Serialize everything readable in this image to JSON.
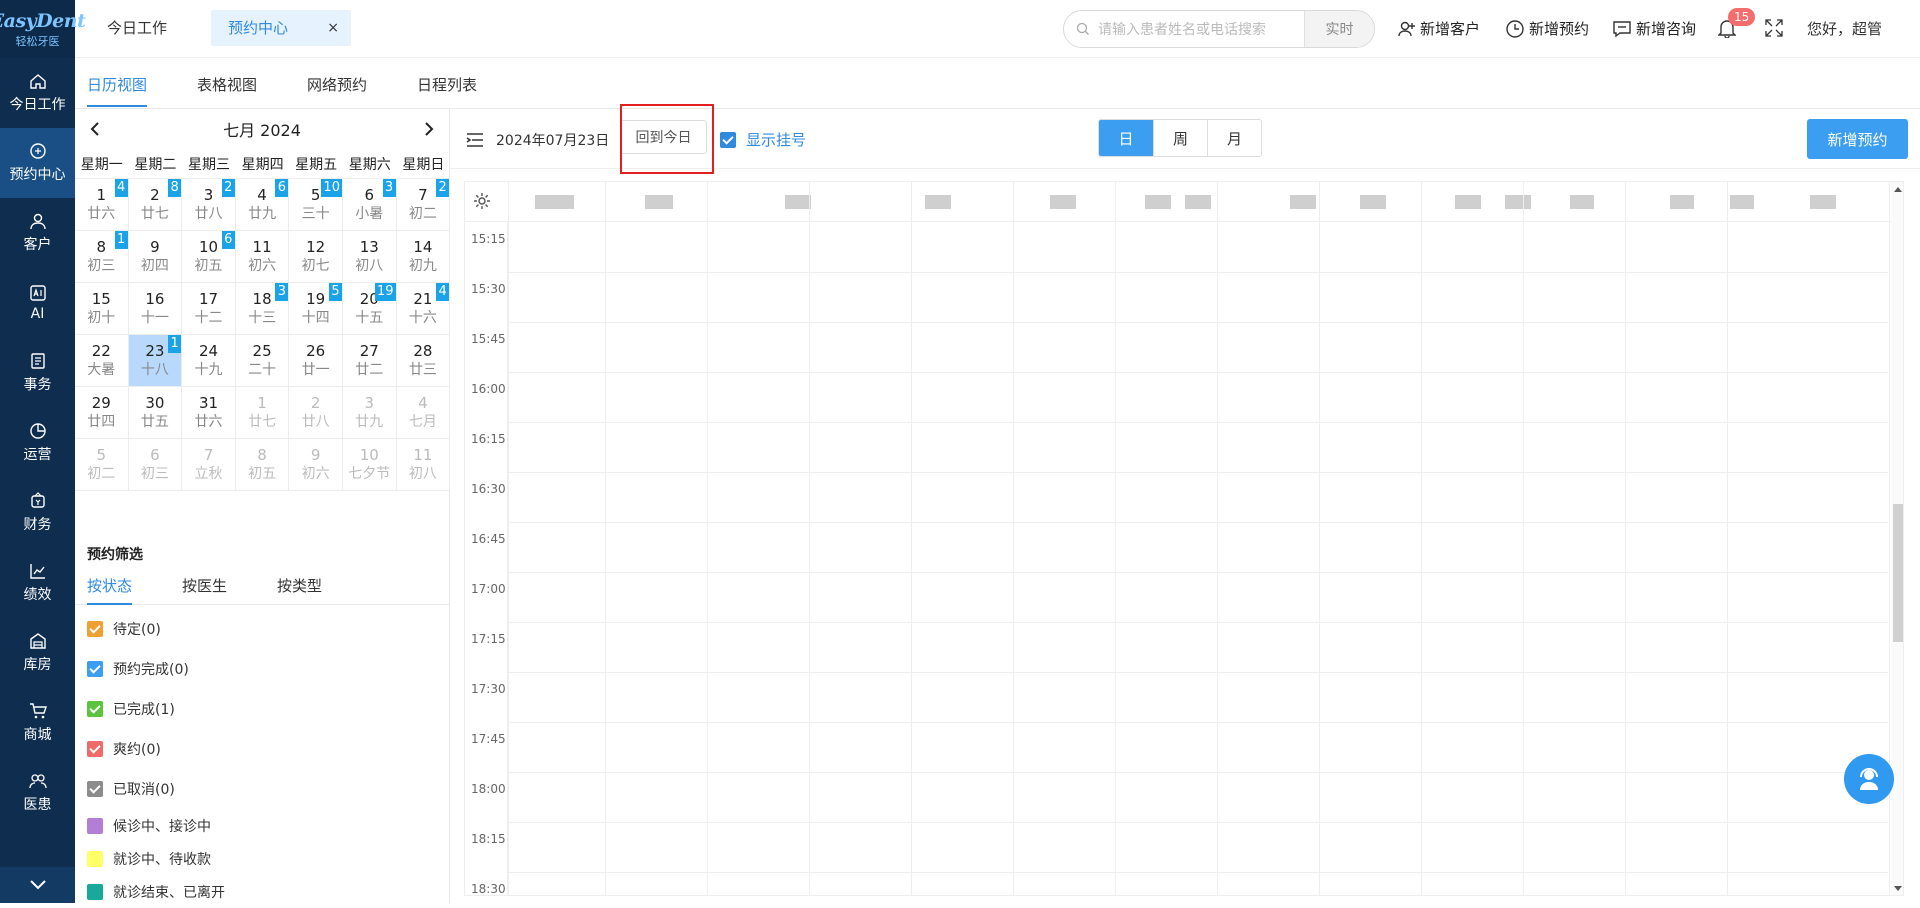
{
  "sidebar": {
    "logo_text": "EasyDent",
    "logo_sub": "轻松牙医",
    "items": [
      {
        "label": "今日工作",
        "icon": "home-icon"
      },
      {
        "label": "预约中心",
        "icon": "appointment-icon"
      },
      {
        "label": "客户",
        "icon": "user-icon"
      },
      {
        "label": "AI",
        "icon": "ai-icon"
      },
      {
        "label": "事务",
        "icon": "task-icon"
      },
      {
        "label": "运营",
        "icon": "pie-icon"
      },
      {
        "label": "财务",
        "icon": "finance-icon"
      },
      {
        "label": "绩效",
        "icon": "chart-icon"
      },
      {
        "label": "库房",
        "icon": "warehouse-icon"
      },
      {
        "label": "商城",
        "icon": "cart-icon"
      },
      {
        "label": "医患",
        "icon": "doctor-patient-icon"
      }
    ]
  },
  "topbar": {
    "tab_today": "今日工作",
    "tab_appt": "预约中心",
    "tab_close": "×",
    "search_placeholder": "请输入患者姓名或电话搜索",
    "search_btn": "实时",
    "add_customer": "新增客户",
    "add_appt": "新增预约",
    "add_consult": "新增咨询",
    "notify_count": "15",
    "greeting": "您好，超管"
  },
  "subtabs": [
    "日历视图",
    "表格视图",
    "网络预约",
    "日程列表"
  ],
  "calendar": {
    "title": "七月 2024",
    "weekdays": [
      "星期一",
      "星期二",
      "星期三",
      "星期四",
      "星期五",
      "星期六",
      "星期日"
    ],
    "weeks": [
      [
        {
          "d": "1",
          "l": "廿六",
          "c": "4"
        },
        {
          "d": "2",
          "l": "廿七",
          "c": "8"
        },
        {
          "d": "3",
          "l": "廿八",
          "c": "2"
        },
        {
          "d": "4",
          "l": "廿九",
          "c": "6"
        },
        {
          "d": "5",
          "l": "三十",
          "c": "10"
        },
        {
          "d": "6",
          "l": "小暑",
          "c": "3"
        },
        {
          "d": "7",
          "l": "初二",
          "c": "2"
        }
      ],
      [
        {
          "d": "8",
          "l": "初三",
          "c": "1"
        },
        {
          "d": "9",
          "l": "初四",
          "c": ""
        },
        {
          "d": "10",
          "l": "初五",
          "c": "6"
        },
        {
          "d": "11",
          "l": "初六",
          "c": ""
        },
        {
          "d": "12",
          "l": "初七",
          "c": ""
        },
        {
          "d": "13",
          "l": "初八",
          "c": ""
        },
        {
          "d": "14",
          "l": "初九",
          "c": ""
        }
      ],
      [
        {
          "d": "15",
          "l": "初十",
          "c": ""
        },
        {
          "d": "16",
          "l": "十一",
          "c": ""
        },
        {
          "d": "17",
          "l": "十二",
          "c": ""
        },
        {
          "d": "18",
          "l": "十三",
          "c": "3"
        },
        {
          "d": "19",
          "l": "十四",
          "c": "5"
        },
        {
          "d": "20",
          "l": "十五",
          "c": "19"
        },
        {
          "d": "21",
          "l": "十六",
          "c": "4"
        }
      ],
      [
        {
          "d": "22",
          "l": "大暑",
          "c": ""
        },
        {
          "d": "23",
          "l": "十八",
          "c": "1",
          "sel": true
        },
        {
          "d": "24",
          "l": "十九",
          "c": ""
        },
        {
          "d": "25",
          "l": "二十",
          "c": ""
        },
        {
          "d": "26",
          "l": "廿一",
          "c": ""
        },
        {
          "d": "27",
          "l": "廿二",
          "c": ""
        },
        {
          "d": "28",
          "l": "廿三",
          "c": ""
        }
      ],
      [
        {
          "d": "29",
          "l": "廿四",
          "c": ""
        },
        {
          "d": "30",
          "l": "廿五",
          "c": ""
        },
        {
          "d": "31",
          "l": "廿六",
          "c": ""
        },
        {
          "d": "1",
          "l": "廿七",
          "c": "",
          "o": true
        },
        {
          "d": "2",
          "l": "廿八",
          "c": "",
          "o": true
        },
        {
          "d": "3",
          "l": "廿九",
          "c": "",
          "o": true
        },
        {
          "d": "4",
          "l": "七月",
          "c": "",
          "o": true
        }
      ],
      [
        {
          "d": "5",
          "l": "初二",
          "c": "",
          "o": true
        },
        {
          "d": "6",
          "l": "初三",
          "c": "",
          "o": true
        },
        {
          "d": "7",
          "l": "立秋",
          "c": "",
          "o": true
        },
        {
          "d": "8",
          "l": "初五",
          "c": "",
          "o": true
        },
        {
          "d": "9",
          "l": "初六",
          "c": "",
          "o": true
        },
        {
          "d": "10",
          "l": "七夕节",
          "c": "",
          "o": true
        },
        {
          "d": "11",
          "l": "初八",
          "c": "",
          "o": true
        }
      ]
    ]
  },
  "filter": {
    "title": "预约筛选",
    "tabs": [
      "按状态",
      "按医生",
      "按类型"
    ],
    "items": [
      {
        "label": "待定(0)",
        "color": "#f0a030"
      },
      {
        "label": "预约完成(0)",
        "color": "#3b9ef0"
      },
      {
        "label": "已完成(1)",
        "color": "#5cc43c"
      },
      {
        "label": "爽约(0)",
        "color": "#f06a6a"
      },
      {
        "label": "已取消(0)",
        "color": "#8c8c8c"
      }
    ],
    "legend": [
      {
        "label": "候诊中、接诊中",
        "color": "#b37fd6"
      },
      {
        "label": "就诊中、待收款",
        "color": "#ffff66"
      },
      {
        "label": "就诊结束、已离开",
        "color": "#1aa89a"
      }
    ]
  },
  "main": {
    "date": "2024年07月23日",
    "today_btn": "回到今日",
    "show_reg": "显示挂号",
    "views": [
      "日",
      "周",
      "月"
    ],
    "new_btn": "新增预约",
    "times": [
      "15:15",
      "15:30",
      "15:45",
      "16:00",
      "16:15",
      "16:30",
      "16:45",
      "17:00",
      "17:15",
      "17:30",
      "17:45",
      "18:00",
      "18:15",
      "18:30"
    ]
  }
}
